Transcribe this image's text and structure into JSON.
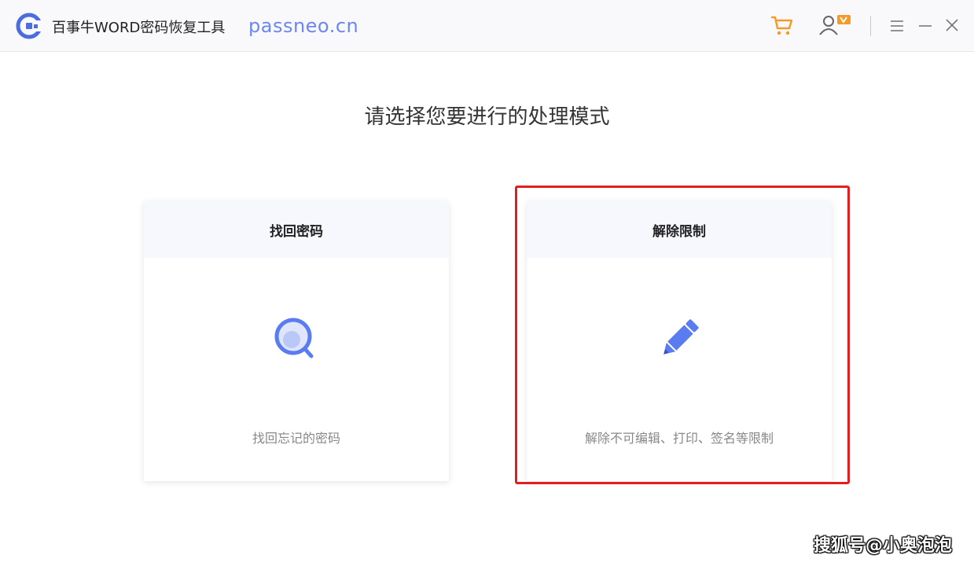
{
  "titlebar": {
    "app_title": "百事牛WORD密码恢复工具",
    "site_label": "passneo.cn",
    "logo_icon": "app-logo-icon",
    "cart_icon": "shopping-cart-icon",
    "user_icon": "user-vip-icon",
    "menu_icon": "hamburger-menu-icon",
    "minimize_icon": "minimize-icon",
    "close_icon": "close-icon"
  },
  "main": {
    "heading": "请选择您要进行的处理模式",
    "cards": [
      {
        "title": "找回密码",
        "icon": "magnifier-icon",
        "description": "找回忘记的密码"
      },
      {
        "title": "解除限制",
        "icon": "pencil-icon",
        "description": "解除不可编辑、打印、签名等限制",
        "highlighted": true
      }
    ]
  },
  "watermark": "搜狐号@小奥泡泡",
  "colors": {
    "accent": "#5b7cf0",
    "cart_orange": "#f59a23",
    "highlight_red": "#e02020",
    "card_header_bg": "#f7f8fd"
  }
}
